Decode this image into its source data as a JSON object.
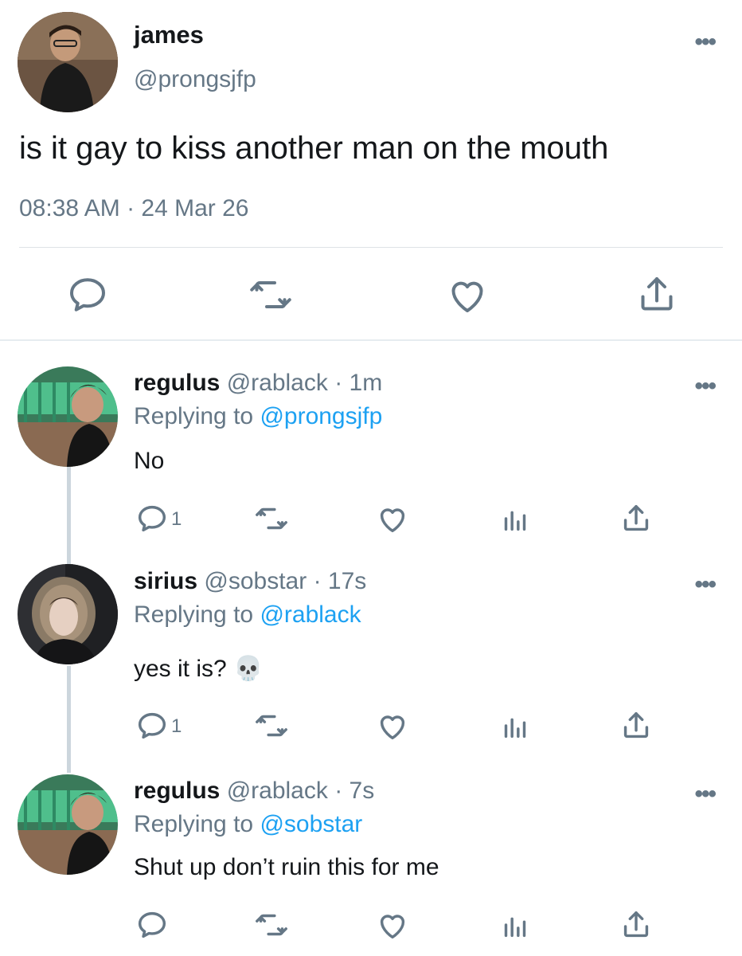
{
  "main_tweet": {
    "name": "james",
    "handle": "@prongsjfp",
    "text": "is it gay to kiss another man on the mouth",
    "timestamp": "08:38 AM · 24 Mar 26",
    "actions": [
      "reply-icon",
      "retweet-icon",
      "like-icon",
      "share-icon"
    ]
  },
  "replies": [
    {
      "name": "regulus",
      "handle": "@rablack",
      "time": "· 1m",
      "replying_prefix": "Replying to ",
      "replying_to": "@prongsjfp",
      "text": "No",
      "reply_count": "1"
    },
    {
      "name": "sirius",
      "handle": "@sobstar",
      "time": "· 17s",
      "replying_prefix": "Replying to ",
      "replying_to": "@rablack",
      "text": "yes it is? 💀",
      "reply_count": "1"
    },
    {
      "name": "regulus",
      "handle": "@rablack",
      "time": "· 7s",
      "replying_prefix": "Replying to ",
      "replying_to": "@sobstar",
      "text": "Shut up don’t ruin this for me",
      "reply_count": ""
    }
  ],
  "more_label": "•••",
  "colors": {
    "text": "#14171a",
    "secondary": "#657786",
    "link": "#1da1f2",
    "divider": "#e6ecf0",
    "thread_line": "#ccd6dd"
  }
}
